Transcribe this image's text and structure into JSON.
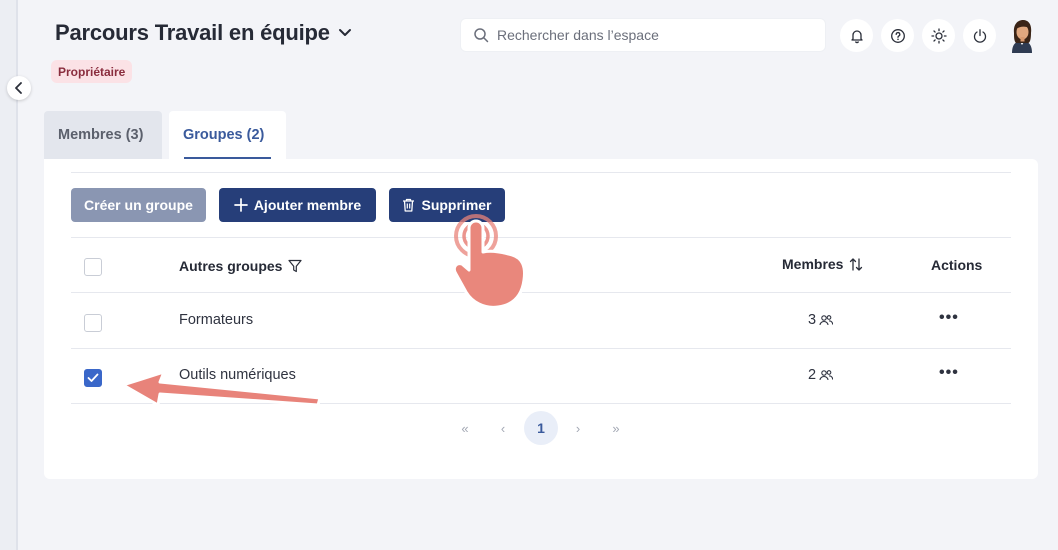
{
  "header": {
    "title": "Parcours Travail en équipe",
    "role_badge": "Propriétaire"
  },
  "search": {
    "placeholder": "Rechercher dans l’espace"
  },
  "icons": {
    "notifications": "bell-icon",
    "help": "help-icon",
    "theme": "sun-icon",
    "logout": "power-icon",
    "avatar": "avatar"
  },
  "tabs": [
    {
      "label": "Membres (3)",
      "active": false
    },
    {
      "label": "Groupes (2)",
      "active": true
    }
  ],
  "toolbar": {
    "create_label": "Créer un groupe",
    "add_member_label": "Ajouter membre",
    "delete_label": "Supprimer"
  },
  "table": {
    "columns": {
      "name": "Autres groupes",
      "members": "Membres",
      "actions": "Actions"
    },
    "rows": [
      {
        "name": "Formateurs",
        "members": "3",
        "checked": false
      },
      {
        "name": "Outils numériques",
        "members": "2",
        "checked": true
      }
    ],
    "actions_glyph": "•••"
  },
  "pagination": {
    "first": "«",
    "prev": "‹",
    "current": "1",
    "next": "›",
    "last": "»"
  },
  "colors": {
    "primary": "#263e79",
    "accent": "#3a5a9c",
    "badge_bg": "#fbe2e6",
    "annotation": "#e8837a"
  }
}
